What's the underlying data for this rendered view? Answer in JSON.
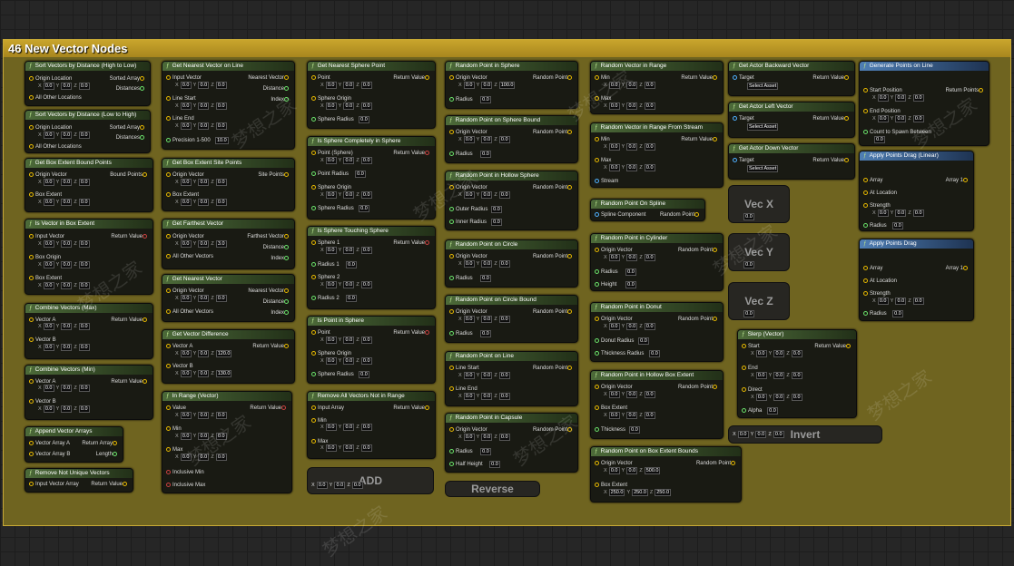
{
  "comment": {
    "title": "46 New Vector Nodes"
  },
  "watermark": "梦想之家",
  "nodes": {
    "sort_high_low": {
      "title": "Sort Vectors by Distance (High to Low)",
      "origin": "Origin Location",
      "sorted": "Sorted Array",
      "distances": "Distances",
      "others": "All Other Locations"
    },
    "sort_low_high": {
      "title": "Sort Vectors by Distance (Low to High)",
      "origin": "Origin Location",
      "sorted": "Sorted Array",
      "distances": "Distances",
      "others": "All Other Locations"
    },
    "box_bound_points": {
      "title": "Get Box Extent Bound Points",
      "origin": "Origin Vector",
      "bound": "Bound Points",
      "extent": "Box Extent"
    },
    "in_box": {
      "title": "Is Vector in Box Extent",
      "input": "Input Vector",
      "ret": "Return Value",
      "origin": "Box Origin",
      "extent": "Box Extent"
    },
    "combine_max": {
      "title": "Combine Vectors (Max)",
      "a": "Vector A",
      "b": "Vector B",
      "ret": "Return Value"
    },
    "combine_min": {
      "title": "Combine Vectors (Min)",
      "a": "Vector A",
      "b": "Vector B",
      "ret": "Return Value"
    },
    "append": {
      "title": "Append Vector Arrays",
      "a": "Vector Array A",
      "b": "Vector Array B",
      "ret": "Return Array",
      "len": "Length"
    },
    "remove_unique": {
      "title": "Remove Not Unique Vectors",
      "input": "Input Vector Array",
      "ret": "Return Value"
    },
    "nearest_line": {
      "title": "Get Nearest Vector on Line",
      "input": "Input Vector",
      "nearest": "Nearest Vector",
      "distance": "Distance",
      "index": "Index",
      "start": "Line Start",
      "end": "Line End",
      "precision": "Precision 1-500",
      "precision_val": "10.0"
    },
    "site_points": {
      "title": "Get Box Extent Site Points",
      "origin": "Origin Vector",
      "site": "Site Points",
      "extent": "Box Extent"
    },
    "farthest": {
      "title": "Get Farthest Vector",
      "origin": "Origin Vector",
      "farthest": "Farthest Vector",
      "distance": "Distance",
      "index": "Index",
      "others": "All Other Vectors",
      "oz": "3.0"
    },
    "nearest": {
      "title": "Get Nearest Vector",
      "origin": "Origin Vector",
      "nearest": "Nearest Vector",
      "distance": "Distance",
      "index": "Index",
      "others": "All Other Vectors"
    },
    "difference": {
      "title": "Get Vector Difference",
      "a": "Vector A",
      "b": "Vector B",
      "ret": "Return Value",
      "az": "120.0",
      "bz": "130.0"
    },
    "in_range": {
      "title": "In Range (Vector)",
      "value": "Value",
      "ret": "Return Value",
      "min": "Min",
      "max": "Max",
      "imin": "Inclusive Min",
      "imax": "Inclusive Max"
    },
    "nearest_sphere": {
      "title": "Get Nearest Sphere Point",
      "point": "Point",
      "ret": "Return Value",
      "origin": "Sphere Origin",
      "radius": "Sphere Radius"
    },
    "sphere_inside": {
      "title": "Is Sphere Completely in Sphere",
      "point": "Point (Sphere)",
      "ret": "Return Value",
      "pradius": "Point Radius",
      "origin": "Sphere Origin",
      "radius": "Sphere Radius"
    },
    "sphere_touch": {
      "title": "Is Sphere Touching Sphere",
      "s1": "Sphere 1",
      "ret": "Return Value",
      "r1": "Radius 1",
      "s2": "Sphere 2",
      "r2": "Radius 2"
    },
    "point_in_sphere": {
      "title": "Is Point in Sphere",
      "point": "Point",
      "ret": "Return Value",
      "origin": "Sphere Origin",
      "radius": "Sphere Radius"
    },
    "remove_not_in_range": {
      "title": "Remove All Vectors Not in Range",
      "input": "Input Array",
      "ret": "Return Value",
      "min": "Min",
      "max": "Max"
    },
    "add": {
      "label": "ADD"
    },
    "rp_sphere": {
      "title": "Random Point in Sphere",
      "origin": "Origin Vector",
      "ret": "Random Point",
      "radius": "Radius",
      "oz": "100.0"
    },
    "rp_sphere_bound": {
      "title": "Random Point on Sphere Bound",
      "origin": "Origin Vector",
      "ret": "Random Point",
      "radius": "Radius"
    },
    "rp_hollow": {
      "title": "Random Point in Hollow Sphere",
      "origin": "Origin Vector",
      "ret": "Random Point",
      "outer": "Outer Radius",
      "inner": "Inner Radius"
    },
    "rp_circle": {
      "title": "Random Point on Circle",
      "origin": "Origin Vector",
      "ret": "Random Point",
      "radius": "Radius"
    },
    "rp_circle_bound": {
      "title": "Random Point on Circle Bound",
      "origin": "Origin Vector",
      "ret": "Random Point",
      "radius": "Radius"
    },
    "rp_line": {
      "title": "Random Point on Line",
      "start": "Line Start",
      "ret": "Random Point",
      "end": "Line End"
    },
    "rp_capsule": {
      "title": "Random Point in Capsule",
      "origin": "Origin Vector",
      "ret": "Random Point",
      "radius": "Radius",
      "half": "Half Height"
    },
    "reverse": {
      "label": "Reverse"
    },
    "rv_range": {
      "title": "Random Vector in Range",
      "min": "Min",
      "ret": "Return Value",
      "max": "Max"
    },
    "rv_stream": {
      "title": "Random Vector in Range From Stream",
      "min": "Min",
      "ret": "Return Value",
      "max": "Max",
      "stream": "Stream"
    },
    "rp_spline": {
      "title": "Random Point On Spline",
      "spline": "Spline Component",
      "ret": "Random Point"
    },
    "rp_cylinder": {
      "title": "Random Point in Cylinder",
      "origin": "Origin Vector",
      "ret": "Random Point",
      "radius": "Radius",
      "height": "Height"
    },
    "rp_donut": {
      "title": "Random Point in Donut",
      "origin": "Origin Vector",
      "ret": "Random Point",
      "dradius": "Donut Radius",
      "thick": "Thickness Radius"
    },
    "rp_hollow_box": {
      "title": "Random Point in Hollow Box Extent",
      "origin": "Origin Vector",
      "ret": "Random Point",
      "extent": "Box Extent",
      "thick": "Thickness"
    },
    "rp_box_bounds": {
      "title": "Random Point on Box Extent Bounds",
      "origin": "Origin Vector",
      "ret": "Random Point",
      "extent": "Box Extent",
      "oz": "500.0",
      "ex": "250.0",
      "ey": "250.0",
      "ez": "250.0"
    },
    "backward": {
      "title": "Get Actor Backward Vector",
      "target": "Target",
      "ret": "Return Value",
      "asset": "Select Asset"
    },
    "left": {
      "title": "Get Actor Left Vector",
      "target": "Target",
      "ret": "Return Value",
      "asset": "Select Asset"
    },
    "down": {
      "title": "Get Actor Down Vector",
      "target": "Target",
      "ret": "Return Value",
      "asset": "Select Asset"
    },
    "vecx": {
      "label": "Vec X"
    },
    "vecy": {
      "label": "Vec Y"
    },
    "vecz": {
      "label": "Vec Z"
    },
    "slerp": {
      "title": "Slerp (Vector)",
      "start": "Start",
      "ret": "Return Value",
      "end": "End",
      "direct": "Direct",
      "alpha": "Alpha"
    },
    "invert": {
      "label": "Invert"
    },
    "gen_line": {
      "title": "Generate Points on Line",
      "start": "Start Position",
      "ret": "Return Points",
      "end": "End Position",
      "count": "Count to Spawn Between"
    },
    "drag_linear": {
      "title": "Apply Points Drag (Linear)",
      "array": "Array",
      "ret": "Array 1",
      "loc": "At Location",
      "strength": "Strength",
      "radius": "Radius"
    },
    "drag": {
      "title": "Apply Points Drag",
      "array": "Array",
      "ret": "Array 1",
      "loc": "At Location",
      "strength": "Strength",
      "radius": "Radius"
    }
  },
  "zero": "0.0",
  "x": "X",
  "y": "Y",
  "z": "Z"
}
